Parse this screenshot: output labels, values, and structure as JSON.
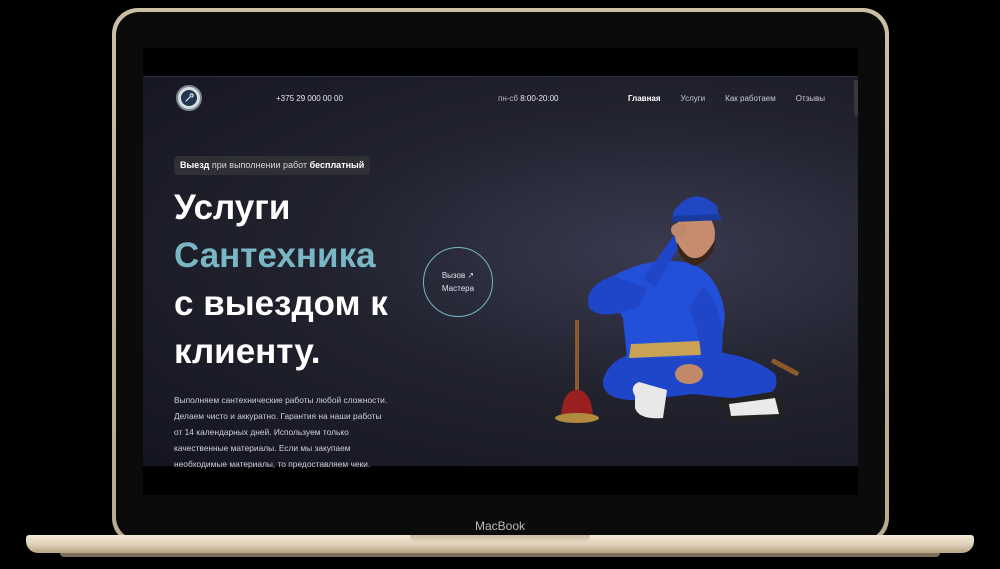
{
  "device": {
    "brand_label": "MacBook"
  },
  "site": {
    "header": {
      "phone": "+375 29 000 00 00",
      "hours_days": "пн-сб",
      "hours_time": "8:00-20:00",
      "nav": [
        {
          "label": "Главная",
          "active": true
        },
        {
          "label": "Услуги"
        },
        {
          "label": "Как работаем"
        },
        {
          "label": "Отзывы"
        }
      ]
    },
    "badge": {
      "bold1": "Выезд",
      "mid": " при выполнении работ ",
      "bold2": "бесплатный"
    },
    "hero": {
      "line1": "Услуги",
      "line2": "Сантехника",
      "line3": "с выездом к",
      "line4": "клиенту."
    },
    "description": [
      "Выполняем сантехнические работы любой сложности.",
      "Делаем чисто и аккуратно. Гарантия на наши работы",
      "от 14 календарных дней. Используем только",
      "качественные материалы. Если мы закупаем",
      "необходимые материалы, то предоставляем чеки."
    ],
    "cta": {
      "line1": "Вызов ↗",
      "line2": "Мастера"
    },
    "colors": {
      "accent": "#79b7c4",
      "background": "#1c1d29",
      "uniform": "#1f46c9"
    }
  }
}
